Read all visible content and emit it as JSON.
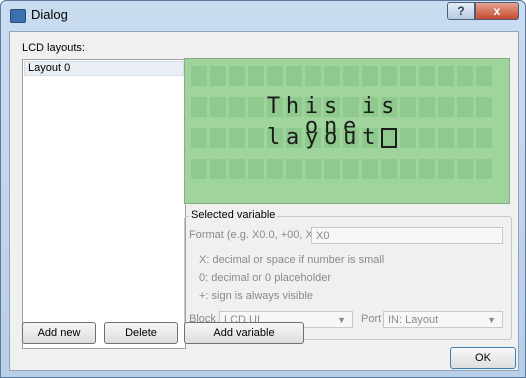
{
  "window": {
    "title": "Dialog",
    "help_label": "?",
    "close_label": "x"
  },
  "layouts_label": "LCD layouts:",
  "layouts": [
    {
      "label": "Layout 0"
    }
  ],
  "lcd": {
    "cols": 16,
    "rows": 4,
    "line1": "This is one",
    "line2": "layout",
    "background": "#9fd49c",
    "cell_color": "#90c98d"
  },
  "selected_variable": {
    "title": "Selected variable",
    "format_label": "Format (e.g. X0.0, +00, X0)",
    "format_value": "X0",
    "help1": "X: decimal or space if number is small",
    "help2": "0: decimal or 0 placeholder",
    "help3": "+: sign is always visible",
    "block_label": "Block",
    "block_value": "LCD UI",
    "port_label": "Port",
    "port_value": "IN: Layout"
  },
  "buttons": {
    "add_new": "Add new",
    "delete": "Delete",
    "add_variable": "Add variable",
    "ok": "OK"
  }
}
